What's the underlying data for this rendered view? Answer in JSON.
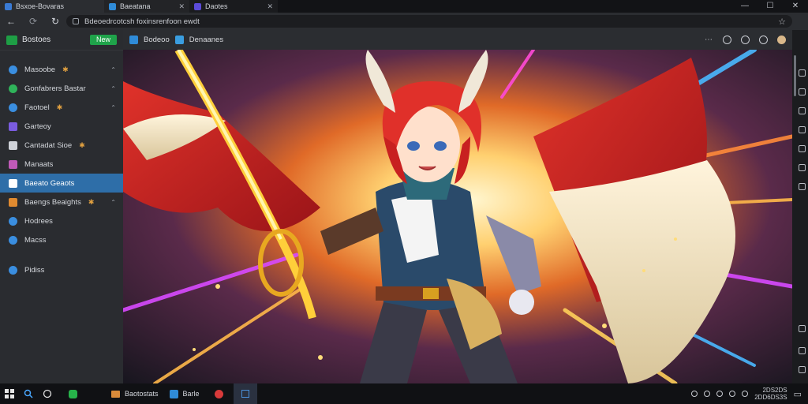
{
  "tabs": [
    {
      "label": "Bsxoe-Bovaras",
      "color": "#3a7bd5"
    },
    {
      "label": "Baeatana",
      "color": "#2f8bd8"
    },
    {
      "label": "Daotes",
      "color": "#5b4bd8"
    }
  ],
  "window_controls": [
    "—",
    "☐",
    "✕"
  ],
  "address": {
    "url": "Bdeoedrcotcsh foxinsrenfoon ewdt"
  },
  "sidebar": {
    "title": "Bostoes",
    "new_button": "New",
    "items": [
      {
        "label": "Masoobe",
        "badge": "✱",
        "icon_color": "#3a8ee0",
        "chev": "⌃"
      },
      {
        "label": "Gonfabrers Bastar",
        "badge": "",
        "icon_color": "#2fb35a",
        "chev": "⌃"
      },
      {
        "label": "Faotoel",
        "badge": "✱",
        "icon_color": "#3a8ee0",
        "chev": "⌃"
      },
      {
        "label": "Garteoy",
        "badge": "",
        "icon_color": "#7a5ce0",
        "chev": ""
      },
      {
        "label": "Cantadat Sioe",
        "badge": "✱",
        "icon_color": "#cfd2d8",
        "chev": ""
      },
      {
        "label": "Manaats",
        "badge": "",
        "icon_color": "#c05ab8",
        "chev": ""
      },
      {
        "label": "Baeato Geaots",
        "badge": "",
        "icon_color": "#ffffff",
        "chev": ""
      },
      {
        "label": "Baengs Beaights",
        "badge": "✱",
        "icon_color": "#e08a30",
        "chev": "⌃"
      },
      {
        "label": "Hodrees",
        "badge": "",
        "icon_color": "#3a8ee0",
        "chev": ""
      },
      {
        "label": "Macss",
        "badge": "",
        "icon_color": "#3a8ee0",
        "chev": ""
      },
      {
        "label": "Pidiss",
        "badge": "",
        "icon_color": "#3a8ee0",
        "chev": ""
      }
    ]
  },
  "toolbar": {
    "label1": "Bodeoo",
    "label2": "Denaanes"
  },
  "taskbar": {
    "apps": [
      {
        "label": "Baotostats",
        "open": false
      },
      {
        "label": "Barle",
        "open": false
      }
    ],
    "clock_time": "2DS2DS",
    "clock_date": "2DD6DS3S"
  }
}
